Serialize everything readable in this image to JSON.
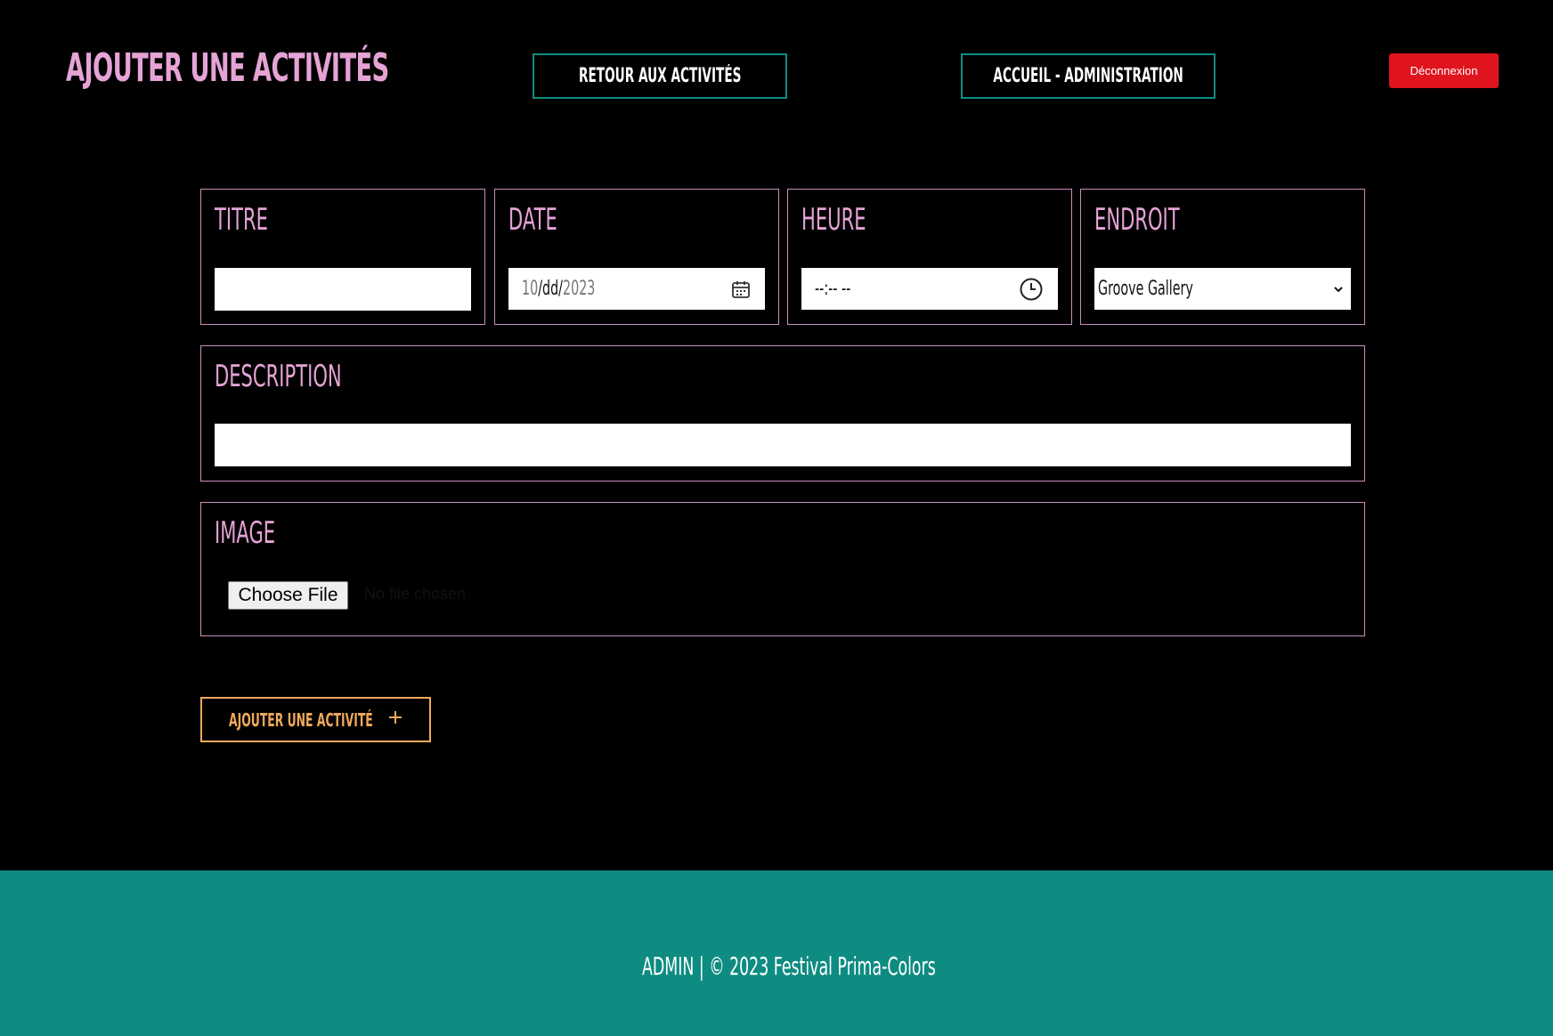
{
  "header": {
    "title": "AJOUTER UNE ACTIVITÉS",
    "back_label": "RETOUR AUX ACTIVITÉS",
    "home_label": "ACCUEIL - ADMINISTRATION",
    "logout_label": "Déconnexion"
  },
  "form": {
    "titre": {
      "label": "TITRE",
      "value": ""
    },
    "date": {
      "label": "DATE",
      "month": "10",
      "sep1": "/",
      "day": "dd",
      "sep2": "/",
      "year": "2023",
      "icon": "calendar-icon"
    },
    "heure": {
      "label": "HEURE",
      "value": "--:-- --",
      "icon": "clock-icon"
    },
    "endroit": {
      "label": "ENDROIT",
      "selected": "Groove Gallery",
      "icon": "chevron-down-icon"
    },
    "description": {
      "label": "DESCRIPTION",
      "value": ""
    },
    "image": {
      "label": "IMAGE",
      "button_label": "Choose File",
      "status": "No file chosen"
    },
    "submit_label": "AJOUTER UNE ACTIVITÉ",
    "submit_icon": "+"
  },
  "footer": {
    "text": "ADMIN | © 2023 Festival Prima-Colors"
  },
  "colors": {
    "background": "#000000",
    "accent_pink": "#e6a3d6",
    "teal": "#0e8c82",
    "logout_red": "#e0141e",
    "submit_orange": "#f0a95c"
  }
}
